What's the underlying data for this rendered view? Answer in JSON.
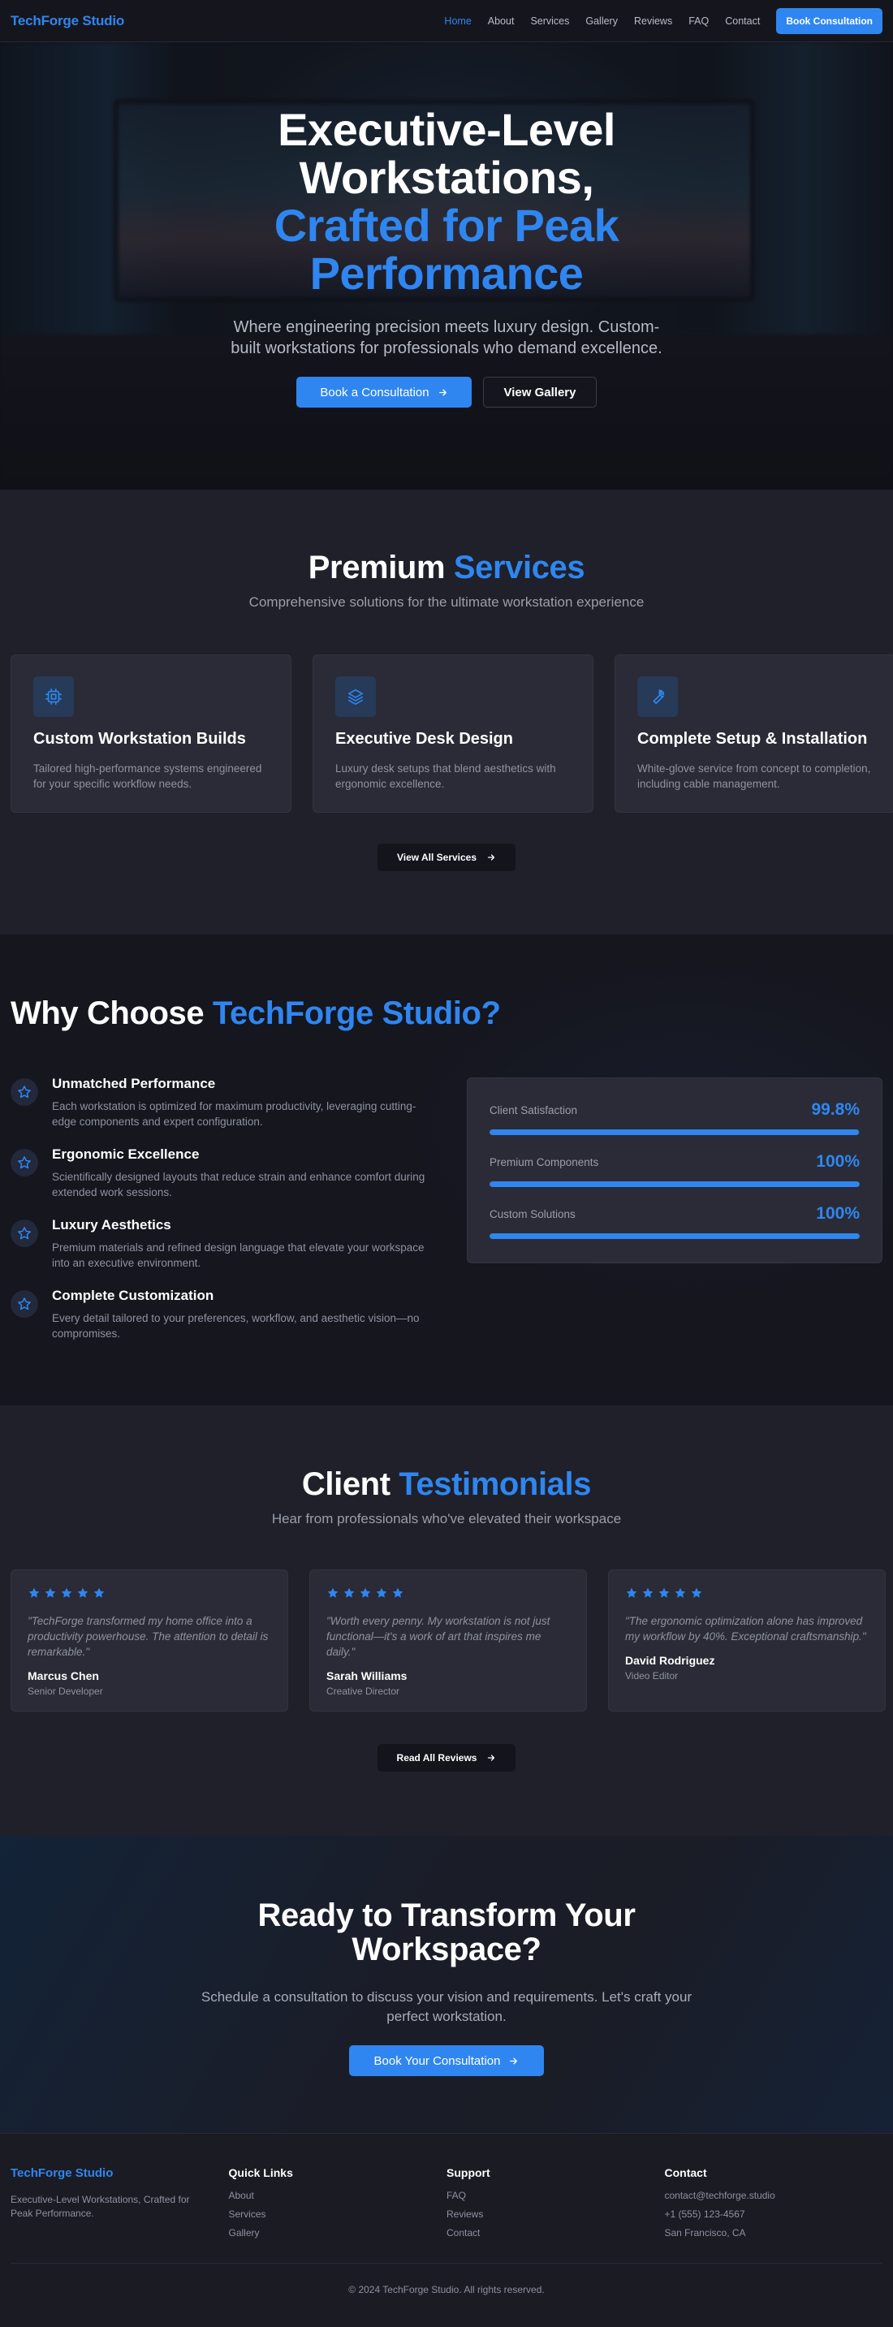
{
  "nav": {
    "logo": "TechForge Studio",
    "links": [
      "Home",
      "About",
      "Services",
      "Gallery",
      "Reviews",
      "FAQ",
      "Contact"
    ],
    "active": "Home",
    "cta": "Book Consultation"
  },
  "hero": {
    "title_line1": "Executive-Level",
    "title_line2": "Workstations,",
    "title_accent_line1": "Crafted for Peak",
    "title_accent_line2": "Performance",
    "subtitle": "Where engineering precision meets luxury design. Custom-built workstations for professionals who demand excellence.",
    "primary_button": "Book a Consultation",
    "secondary_button": "View Gallery"
  },
  "services": {
    "title": "Premium",
    "title_accent": "Services",
    "subtitle": "Comprehensive solutions for the ultimate workstation experience",
    "items": [
      {
        "icon": "cpu-icon",
        "title": "Custom Workstation Builds",
        "description": "Tailored high-performance systems engineered for your specific workflow needs."
      },
      {
        "icon": "layers-icon",
        "title": "Executive Desk Design",
        "description": "Luxury desk setups that blend aesthetics with ergonomic excellence."
      },
      {
        "icon": "wrench-icon",
        "title": "Complete Setup & Installation",
        "description": "White-glove service from concept to completion, including cable management."
      }
    ],
    "button": "View All Services"
  },
  "why": {
    "title": "Why Choose",
    "title_accent": "TechForge Studio?",
    "features": [
      {
        "title": "Unmatched Performance",
        "description": "Each workstation is optimized for maximum productivity, leveraging cutting-edge components and expert configuration."
      },
      {
        "title": "Ergonomic Excellence",
        "description": "Scientifically designed layouts that reduce strain and enhance comfort during extended work sessions."
      },
      {
        "title": "Luxury Aesthetics",
        "description": "Premium materials and refined design language that elevate your workspace into an executive environment."
      },
      {
        "title": "Complete Customization",
        "description": "Every detail tailored to your preferences, workflow, and aesthetic vision—no compromises."
      }
    ],
    "stats": [
      {
        "label": "Client Satisfaction",
        "value": "99.8%",
        "fill": 0.998
      },
      {
        "label": "Premium Components",
        "value": "100%",
        "fill": 1.0
      },
      {
        "label": "Custom Solutions",
        "value": "100%",
        "fill": 1.0
      }
    ]
  },
  "testimonials": {
    "title": "Client",
    "title_accent": "Testimonials",
    "subtitle": "Hear from professionals who've elevated their workspace",
    "items": [
      {
        "rating": 5,
        "quote": "\"TechForge transformed my home office into a productivity powerhouse. The attention to detail is remarkable.\"",
        "name": "Marcus Chen",
        "role": "Senior Developer"
      },
      {
        "rating": 5,
        "quote": "\"Worth every penny. My workstation is not just functional—it's a work of art that inspires me daily.\"",
        "name": "Sarah Williams",
        "role": "Creative Director"
      },
      {
        "rating": 5,
        "quote": "\"The ergonomic optimization alone has improved my workflow by 40%. Exceptional craftsmanship.\"",
        "name": "David Rodriguez",
        "role": "Video Editor"
      }
    ],
    "button": "Read All Reviews"
  },
  "cta": {
    "title_line1": "Ready to Transform Your",
    "title_line2": "Workspace?",
    "text": "Schedule a consultation to discuss your vision and requirements. Let's craft your perfect workstation.",
    "button": "Book Your Consultation"
  },
  "footer": {
    "brand": "TechForge Studio",
    "tagline": "Executive-Level Workstations, Crafted for Peak Performance.",
    "quick_links": {
      "heading": "Quick Links",
      "items": [
        "About",
        "Services",
        "Gallery"
      ]
    },
    "support": {
      "heading": "Support",
      "items": [
        "FAQ",
        "Reviews",
        "Contact"
      ]
    },
    "contact": {
      "heading": "Contact",
      "items": [
        "contact@techforge.studio",
        "+1 (555) 123-4567",
        "San Francisco, CA"
      ]
    },
    "copyright": "© 2024 TechForge Studio. All rights reserved."
  },
  "colors": {
    "accent": "#2f86f0",
    "background": "#1a1b23",
    "card": "#2a2b36"
  }
}
